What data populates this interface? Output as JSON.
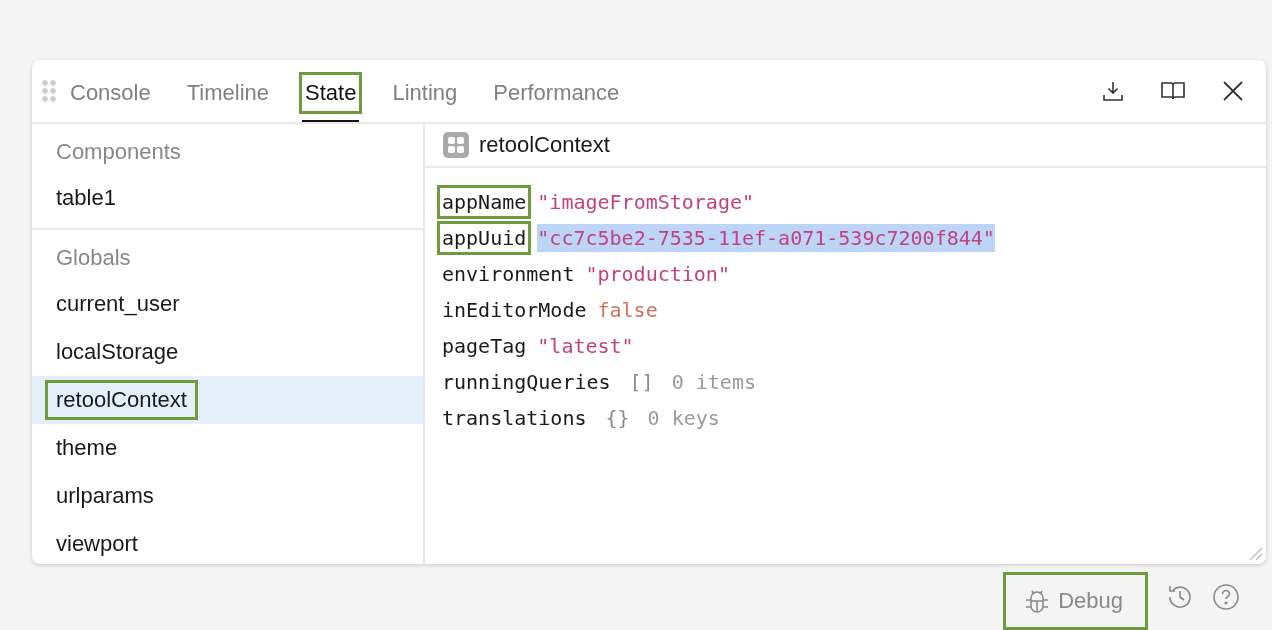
{
  "tabs": [
    {
      "label": "Console",
      "selected": false,
      "highlighted": false
    },
    {
      "label": "Timeline",
      "selected": false,
      "highlighted": false
    },
    {
      "label": "State",
      "selected": true,
      "highlighted": true
    },
    {
      "label": "Linting",
      "selected": false,
      "highlighted": false
    },
    {
      "label": "Performance",
      "selected": false,
      "highlighted": false
    }
  ],
  "sidebar": {
    "sections": [
      {
        "title": "Components",
        "items": [
          {
            "label": "table1",
            "selected": false,
            "highlighted": false
          }
        ]
      },
      {
        "title": "Globals",
        "items": [
          {
            "label": "current_user",
            "selected": false,
            "highlighted": false
          },
          {
            "label": "localStorage",
            "selected": false,
            "highlighted": false
          },
          {
            "label": "retoolContext",
            "selected": true,
            "highlighted": true
          },
          {
            "label": "theme",
            "selected": false,
            "highlighted": false
          },
          {
            "label": "urlparams",
            "selected": false,
            "highlighted": false
          },
          {
            "label": "viewport",
            "selected": false,
            "highlighted": false
          }
        ]
      }
    ]
  },
  "inspector": {
    "title": "retoolContext",
    "properties": [
      {
        "key": "appName",
        "kind": "string",
        "value": "\"imageFromStorage\"",
        "highlighted": true,
        "text_selected": false
      },
      {
        "key": "appUuid",
        "kind": "string",
        "value": "\"cc7c5be2-7535-11ef-a071-539c7200f844\"",
        "highlighted": true,
        "text_selected": true
      },
      {
        "key": "environment",
        "kind": "string",
        "value": "\"production\"",
        "highlighted": false,
        "text_selected": false
      },
      {
        "key": "inEditorMode",
        "kind": "boolean",
        "value": "false",
        "highlighted": false,
        "text_selected": false
      },
      {
        "key": "pageTag",
        "kind": "string",
        "value": "\"latest\"",
        "highlighted": false,
        "text_selected": false
      },
      {
        "key": "runningQueries",
        "kind": "collection",
        "value": "[]",
        "count": "0 items",
        "highlighted": false,
        "text_selected": false
      },
      {
        "key": "translations",
        "kind": "collection",
        "value": "{}",
        "count": "0 keys",
        "highlighted": false,
        "text_selected": false
      }
    ]
  },
  "footer": {
    "debug": {
      "label": "Debug",
      "highlighted": true
    }
  }
}
